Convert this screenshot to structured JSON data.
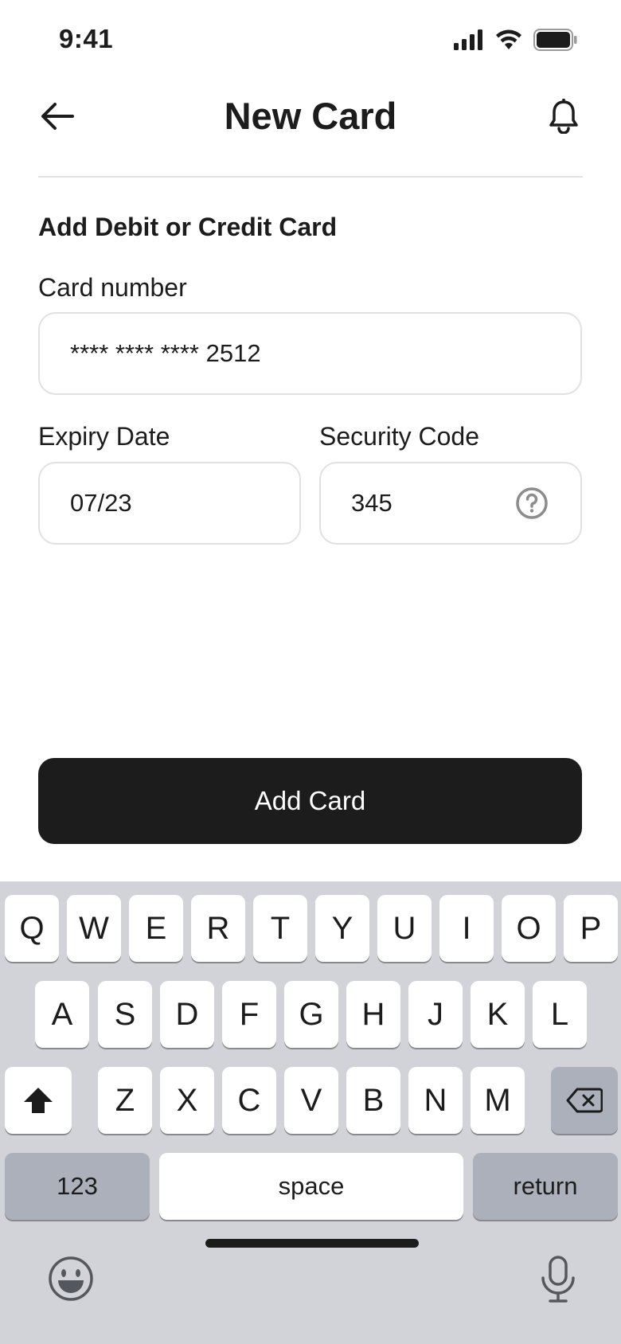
{
  "status_bar": {
    "time": "9:41"
  },
  "nav": {
    "title": "New Card",
    "back_icon": "arrow-left-icon",
    "bell_icon": "bell-icon"
  },
  "form": {
    "section_title": "Add Debit or Credit Card",
    "card_number": {
      "label": "Card number",
      "value": "**** **** **** 2512"
    },
    "expiry": {
      "label": "Expiry Date",
      "value": "07/23"
    },
    "security": {
      "label": "Security Code",
      "value": "345",
      "help_icon": "question-circle-icon"
    }
  },
  "actions": {
    "add_card_label": "Add Card"
  },
  "keyboard": {
    "row1": [
      "Q",
      "W",
      "E",
      "R",
      "T",
      "Y",
      "U",
      "I",
      "O",
      "P"
    ],
    "row2": [
      "A",
      "S",
      "D",
      "F",
      "G",
      "H",
      "J",
      "K",
      "L"
    ],
    "row3": [
      "Z",
      "X",
      "C",
      "V",
      "B",
      "N",
      "M"
    ],
    "numbers_label": "123",
    "space_label": "space",
    "return_label": "return",
    "shift_icon": "shift-arrow-icon",
    "backspace_icon": "backspace-icon",
    "emoji_icon": "emoji-icon",
    "mic_icon": "microphone-icon"
  },
  "colors": {
    "text": "#1c1c1c",
    "button_bg": "#1c1c1c",
    "field_border": "#e1e1e1",
    "keyboard_bg": "#d1d3d9",
    "dark_key": "#abb0bb"
  }
}
